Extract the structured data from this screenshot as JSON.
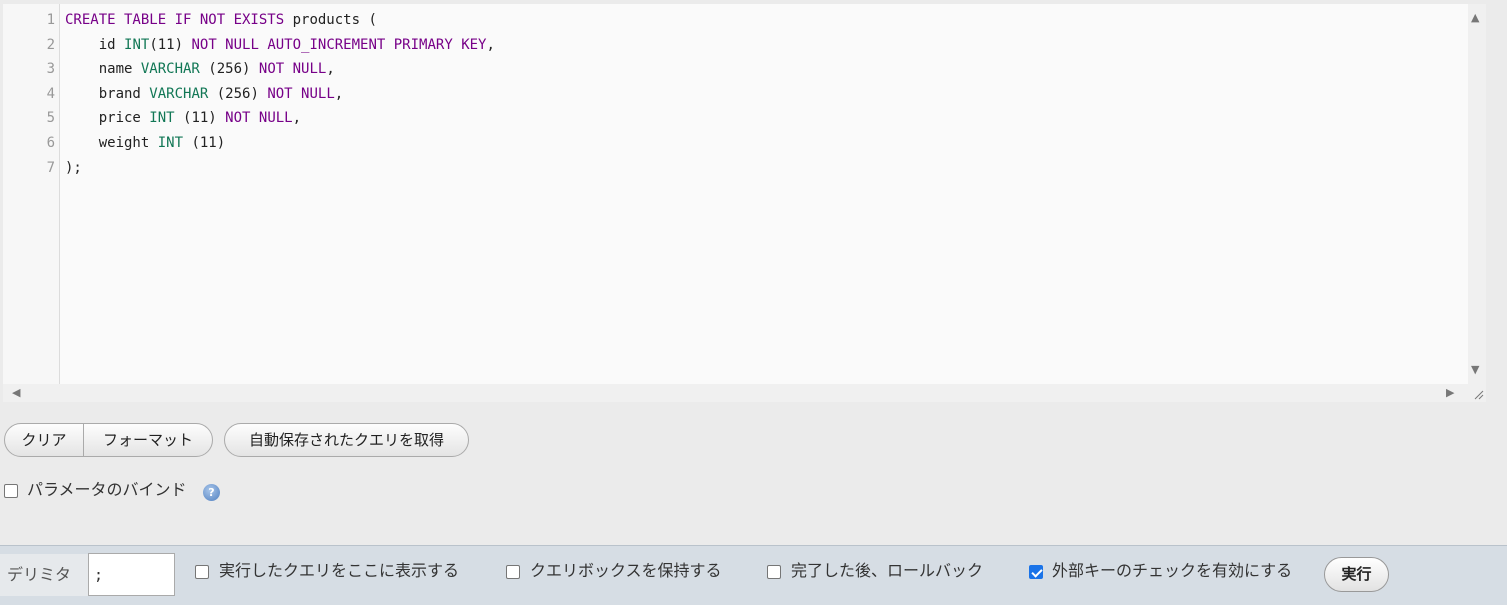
{
  "editor": {
    "line_numbers": [
      "1",
      "2",
      "3",
      "4",
      "5",
      "6",
      "7"
    ],
    "lines": [
      [
        {
          "t": "kw",
          "v": "CREATE TABLE IF NOT EXISTS"
        },
        {
          "t": "pl",
          "v": " products ("
        }
      ],
      [
        {
          "t": "pl",
          "v": "    id "
        },
        {
          "t": "ty",
          "v": "INT"
        },
        {
          "t": "pl",
          "v": "(11) "
        },
        {
          "t": "kw",
          "v": "NOT NULL AUTO_INCREMENT PRIMARY KEY"
        },
        {
          "t": "pl",
          "v": ","
        }
      ],
      [
        {
          "t": "pl",
          "v": "    name "
        },
        {
          "t": "ty",
          "v": "VARCHAR"
        },
        {
          "t": "pl",
          "v": " (256) "
        },
        {
          "t": "kw",
          "v": "NOT NULL"
        },
        {
          "t": "pl",
          "v": ","
        }
      ],
      [
        {
          "t": "pl",
          "v": "    brand "
        },
        {
          "t": "ty",
          "v": "VARCHAR"
        },
        {
          "t": "pl",
          "v": " (256) "
        },
        {
          "t": "kw",
          "v": "NOT NULL"
        },
        {
          "t": "pl",
          "v": ","
        }
      ],
      [
        {
          "t": "pl",
          "v": "    price "
        },
        {
          "t": "ty",
          "v": "INT"
        },
        {
          "t": "pl",
          "v": " (11) "
        },
        {
          "t": "kw",
          "v": "NOT NULL"
        },
        {
          "t": "pl",
          "v": ","
        }
      ],
      [
        {
          "t": "pl",
          "v": "    weight "
        },
        {
          "t": "ty",
          "v": "INT"
        },
        {
          "t": "pl",
          "v": " (11)"
        }
      ],
      [
        {
          "t": "pl",
          "v": ");"
        }
      ]
    ]
  },
  "buttons": {
    "clear": "クリア",
    "format": "フォーマット",
    "get_autosaved": "自動保存されたクエリを取得"
  },
  "bind_parameters": {
    "label": "パラメータのバインド",
    "checked": false,
    "help_icon": "?"
  },
  "bottom_bar": {
    "delimiter_label": "デリミタ",
    "delimiter_value": ";",
    "options": [
      {
        "label": "実行したクエリをここに表示する",
        "checked": false
      },
      {
        "label": "クエリボックスを保持する",
        "checked": false
      },
      {
        "label": "完了した後、ロールバック",
        "checked": false
      },
      {
        "label": "外部キーのチェックを有効にする",
        "checked": true
      }
    ],
    "go_button": "実行"
  },
  "colors": {
    "keyword": "#770088",
    "type": "#117755",
    "checkbox_checked": "#1a73e8"
  }
}
